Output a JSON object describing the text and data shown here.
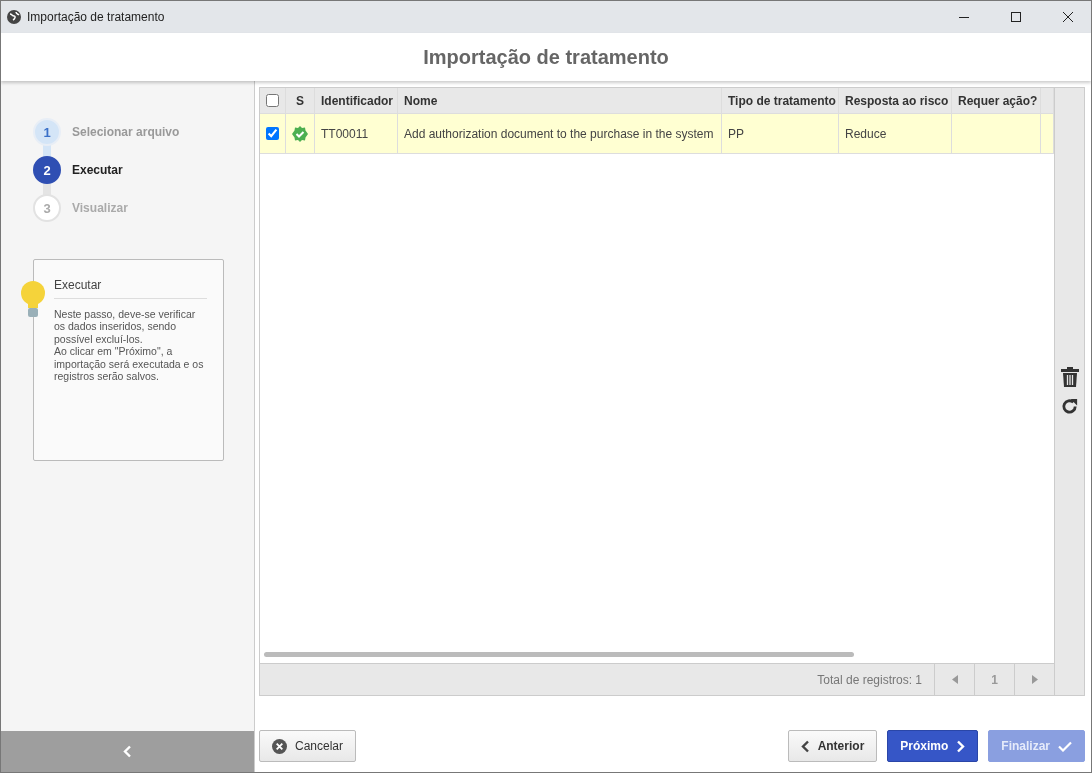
{
  "window": {
    "title": "Importação de tratamento"
  },
  "header": {
    "title": "Importação de tratamento"
  },
  "steps": [
    {
      "number": "1",
      "label": "Selecionar arquivo",
      "done": true,
      "selected": false
    },
    {
      "number": "2",
      "label": "Executar",
      "done": false,
      "selected": true
    },
    {
      "number": "3",
      "label": "Visualizar",
      "done": false,
      "selected": false
    }
  ],
  "tip": {
    "title": "Executar",
    "text": "Neste passo, deve-se verificar os dados inseridos, sendo possível excluí-los.\nAo clicar em \"Próximo\", a importação será executada e os registros serão salvos."
  },
  "table": {
    "all_checked": false,
    "status_column": "S",
    "columns": [
      "Identificador",
      "Nome",
      "Tipo de tratamento",
      "Resposta ao risco",
      "Requer ação?"
    ],
    "rows": [
      {
        "checked": true,
        "selected": true,
        "valid": true,
        "cells": [
          "TT00011",
          "Add authorization document to the purchase in the system",
          "PP",
          "Reduce",
          ""
        ]
      }
    ]
  },
  "pagination": {
    "total": "Total de registros: 1",
    "page": "1",
    "prev_disabled": true,
    "next_disabled": true
  },
  "buttons": [
    {
      "kind": "cancel",
      "label": "Cancelar",
      "disabled": false
    },
    {
      "kind": "back",
      "label": "Anterior",
      "disabled": false
    },
    {
      "kind": "next",
      "label": "Próximo",
      "disabled": false
    },
    {
      "kind": "finish",
      "label": "Finalizar",
      "disabled": true
    }
  ]
}
